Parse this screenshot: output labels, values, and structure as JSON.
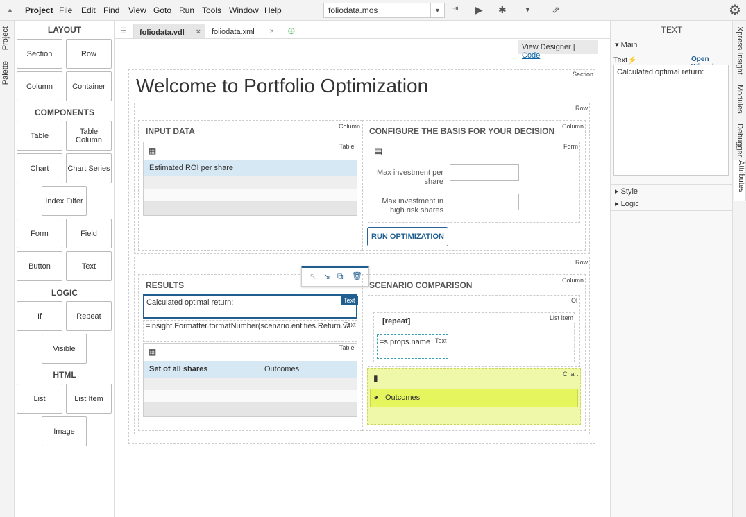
{
  "menubar": {
    "items": [
      "Project",
      "File",
      "Edit",
      "Find",
      "View",
      "Goto",
      "Run",
      "Tools",
      "Window",
      "Help"
    ],
    "file": "foliodata.mos"
  },
  "leftstrip": {
    "tabs": [
      "Project",
      "Palette"
    ]
  },
  "palette": {
    "layout_title": "LAYOUT",
    "layout": [
      "Section",
      "Row",
      "Column",
      "Container"
    ],
    "components_title": "COMPONENTS",
    "components": [
      "Table",
      "Table Column",
      "Chart",
      "Chart Series",
      "Index Filter",
      "Form",
      "Field",
      "Button",
      "Text"
    ],
    "logic_title": "LOGIC",
    "logic": [
      "If",
      "Repeat",
      "Visible"
    ],
    "html_title": "HTML",
    "html": [
      "List",
      "List Item",
      "Image"
    ]
  },
  "tabs": {
    "file1": "foliodata.vdl",
    "file2": "foliodata.xml",
    "close": "×"
  },
  "viewswitch": {
    "designer": "View Designer",
    "sep": "|",
    "code": "Code"
  },
  "canvas": {
    "title": "Welcome to Portfolio Optimization",
    "tags": {
      "section": "Section",
      "row": "Row",
      "column": "Column",
      "table": "Table",
      "form": "Form",
      "text": "Text",
      "ol": "Ol",
      "list_item": "List Item",
      "chart": "Chart"
    },
    "input_data": "INPUT DATA",
    "roi_header": "Estimated ROI per share",
    "configure": "CONFIGURE THE BASIS FOR YOUR DECISION",
    "max_inv_label": "Max investment per share",
    "max_risk_label": "Max investment in high risk shares",
    "run_button": "RUN OPTIMIZATION",
    "results": "RESULTS",
    "calc_return": "Calculated optimal return:",
    "formatter": "=insight.Formatter.formatNumber(scenario.entities.Return.va",
    "set_shares": "Set of all shares",
    "outcomes": "Outcomes",
    "scenario_comparison": "SCENARIO COMPARISON",
    "repeat": "[repeat]",
    "props_name": "=s.props.name",
    "chart_series": "Outcomes"
  },
  "right": {
    "title": "TEXT",
    "main": "Main",
    "text_label": "Text",
    "open_wizard": "Open Wizard",
    "text_value": "Calculated optimal return:",
    "style": "Style",
    "logic": "Logic"
  },
  "rightstrip": {
    "tabs": [
      "Xpress Insight",
      "Modules",
      "Debugger",
      "Attributes"
    ]
  }
}
